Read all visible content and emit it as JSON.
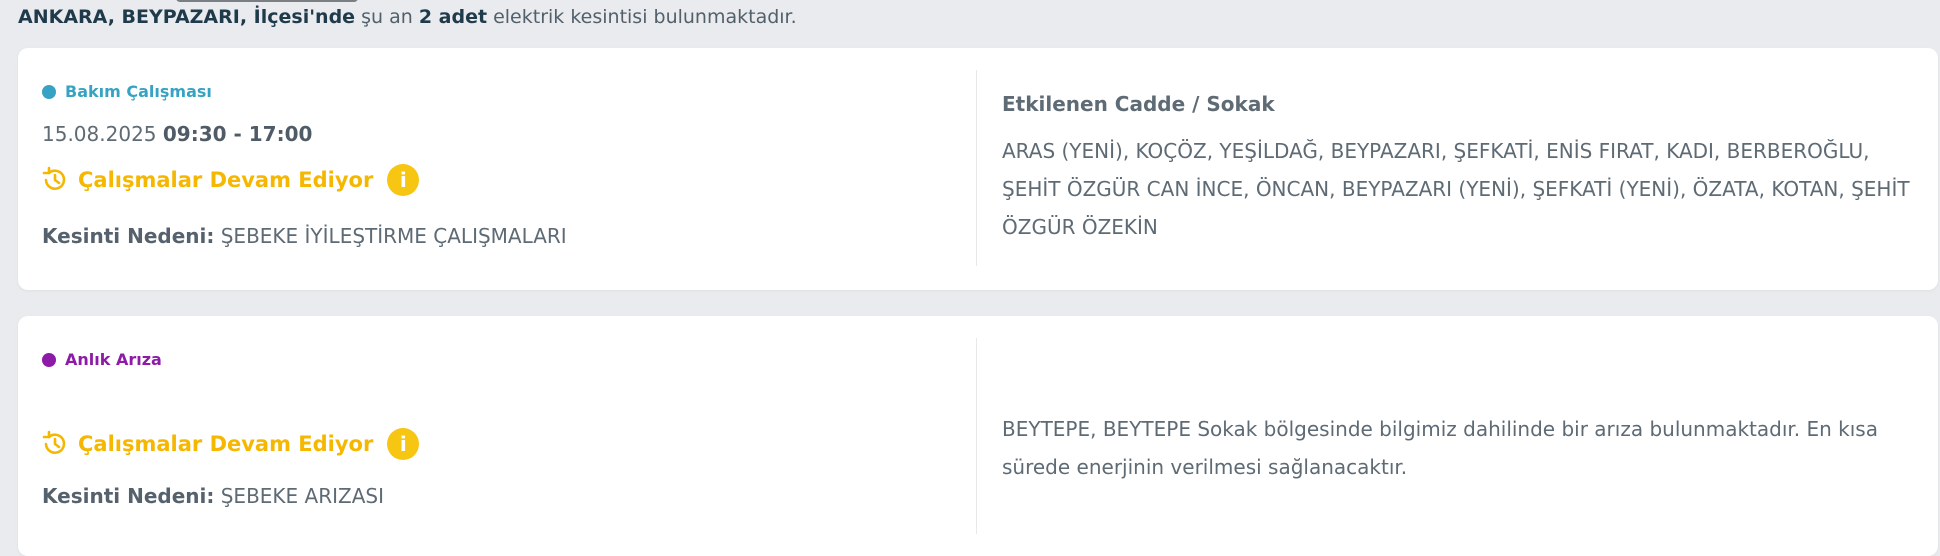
{
  "summary": {
    "location": "ANKARA, BEYPAZARI, İlçesi'nde",
    "text_before_count": " şu an ",
    "count": "2 adet",
    "text_after_count": " elektrik kesintisi bulunmaktadır."
  },
  "outages": [
    {
      "type_label": "Bakım Çalışması",
      "type_color": "#36a3c4",
      "date": "15.08.2025",
      "time": "09:30 - 17:00",
      "status": "Çalışmalar Devam Ediyor",
      "status_color": "#f5b700",
      "info_icon": "i",
      "reason_label": "Kesinti Nedeni:",
      "reason": "ŞEBEKE İYİLEŞTİRME ÇALIŞMALARI",
      "affected_title": "Etkilenen Cadde / Sokak",
      "affected_text": "ARAS (YENİ), KOÇÖZ, YEŞİLDAĞ, BEYPAZARI, ŞEFKATİ, ENİS FIRAT, KADI, BERBEROĞLU, ŞEHİT ÖZGÜR CAN İNCE, ÖNCAN, BEYPAZARI (YENİ), ŞEFKATİ (YENİ), ÖZATA, KOTAN, ŞEHİT ÖZGÜR ÖZEKİN"
    },
    {
      "type_label": "Anlık Arıza",
      "type_color": "#8e1aa8",
      "status": "Çalışmalar Devam Ediyor",
      "status_color": "#f5b700",
      "info_icon": "i",
      "reason_label": "Kesinti Nedeni:",
      "reason": "ŞEBEKE ARIZASI",
      "affected_text": "BEYTEPE, BEYTEPE Sokak bölgesinde bilgimiz dahilinde bir arıza bulunmaktadır. En kısa sürede enerjinin verilmesi sağlanacaktır."
    }
  ]
}
